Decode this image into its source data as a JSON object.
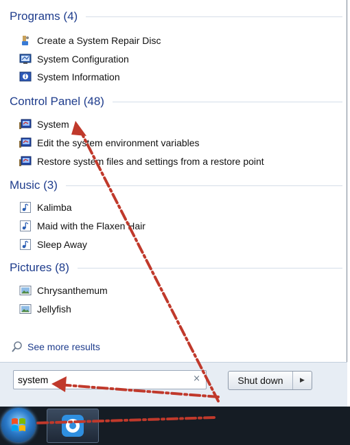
{
  "groups": {
    "programs": {
      "title": "Programs (4)",
      "items": [
        {
          "label": "Create a System Repair Disc",
          "icon": "repair-disc-icon"
        },
        {
          "label": "System Configuration",
          "icon": "system-config-icon"
        },
        {
          "label": "System Information",
          "icon": "system-info-icon"
        }
      ]
    },
    "control_panel": {
      "title": "Control Panel (48)",
      "items": [
        {
          "label": "System",
          "icon": "control-panel-icon"
        },
        {
          "label": "Edit the system environment variables",
          "icon": "control-panel-icon"
        },
        {
          "label": "Restore system files and settings from a restore point",
          "icon": "control-panel-icon"
        }
      ]
    },
    "music": {
      "title": "Music (3)",
      "items": [
        {
          "label": "Kalimba",
          "icon": "music-note-icon"
        },
        {
          "label": "Maid with the Flaxen Hair",
          "icon": "music-note-icon"
        },
        {
          "label": "Sleep Away",
          "icon": "music-note-icon"
        }
      ]
    },
    "pictures": {
      "title": "Pictures (8)",
      "items": [
        {
          "label": "Chrysanthemum",
          "icon": "picture-icon"
        },
        {
          "label": "Jellyfish",
          "icon": "picture-icon"
        }
      ]
    }
  },
  "see_more": {
    "label": "See more results",
    "icon": "search-icon"
  },
  "search": {
    "value": "system",
    "clear": "×"
  },
  "shutdown": {
    "label": "Shut down",
    "arrow": "▶"
  },
  "colors": {
    "header": "#1e3c8c",
    "annotation": "#c0392b"
  }
}
